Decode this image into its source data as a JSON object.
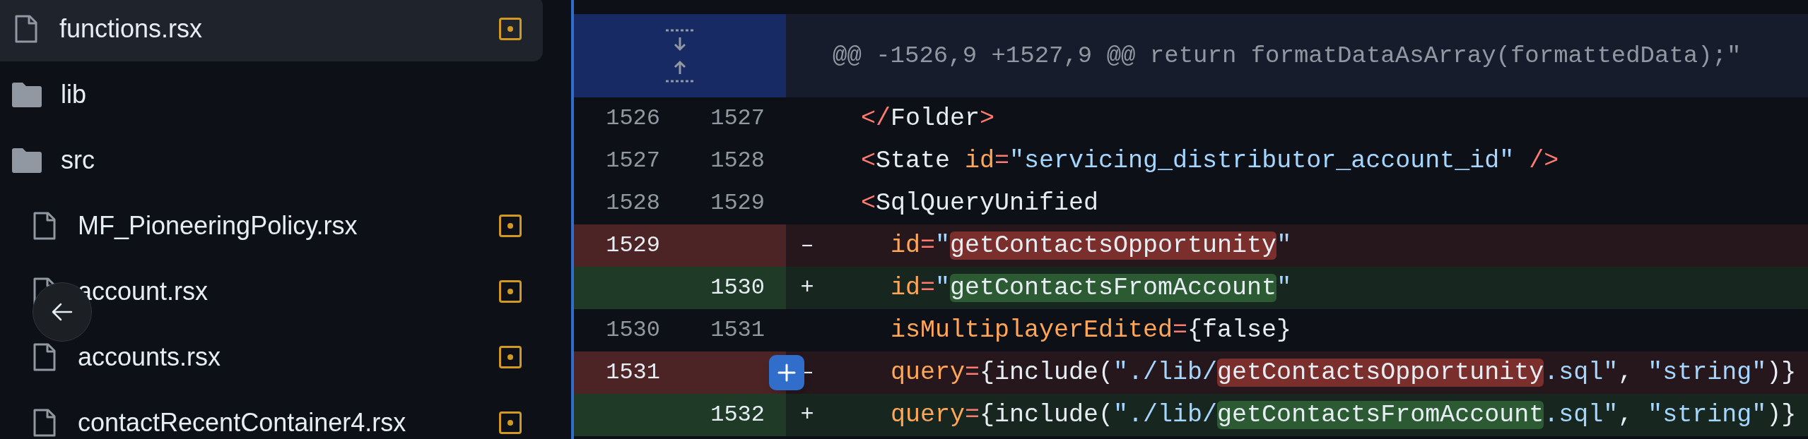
{
  "sidebar": {
    "items": [
      {
        "kind": "file",
        "name": "functions.rsx",
        "selected": true,
        "modified": true
      },
      {
        "kind": "folder",
        "name": "lib",
        "selected": false
      },
      {
        "kind": "folder",
        "name": "src",
        "selected": false,
        "children": [
          {
            "kind": "file",
            "name": "MF_PioneeringPolicy.rsx",
            "selected": false,
            "modified": true
          },
          {
            "kind": "file",
            "name": "account.rsx",
            "selected": false,
            "modified": true
          },
          {
            "kind": "file",
            "name": "accounts.rsx",
            "selected": false,
            "modified": true
          },
          {
            "kind": "file",
            "name": "contactRecentContainer4.rsx",
            "selected": false,
            "modified": true
          }
        ]
      }
    ]
  },
  "diff": {
    "hunk_header": "@@ -1526,9 +1527,9 @@ return formatDataAsArray(formattedData);\"",
    "lines": [
      {
        "kind": "context",
        "old": "1526",
        "new": "1527",
        "tokens": [
          {
            "text": "</",
            "kind": "punct",
            "highlight": false
          },
          {
            "text": "Folder",
            "kind": "tag",
            "highlight": false
          },
          {
            "text": ">",
            "kind": "punct",
            "highlight": false
          }
        ]
      },
      {
        "kind": "context",
        "old": "1527",
        "new": "1528",
        "tokens": [
          {
            "text": "<",
            "kind": "punct",
            "highlight": false
          },
          {
            "text": "State",
            "kind": "tag",
            "highlight": false
          },
          {
            "text": " id",
            "kind": "attr",
            "highlight": false
          },
          {
            "text": "=",
            "kind": "punct",
            "highlight": false
          },
          {
            "text": "\"servicing_distributor_account_id\"",
            "kind": "string",
            "highlight": false
          },
          {
            "text": " />",
            "kind": "punct",
            "highlight": false
          }
        ]
      },
      {
        "kind": "context",
        "old": "1528",
        "new": "1529",
        "tokens": [
          {
            "text": "<",
            "kind": "punct",
            "highlight": false
          },
          {
            "text": "SqlQueryUnified",
            "kind": "tag",
            "highlight": false
          }
        ]
      },
      {
        "kind": "deleted",
        "old": "1529",
        "sign": "–",
        "tokens": [
          {
            "text": "  id",
            "kind": "attr",
            "highlight": false
          },
          {
            "text": "=",
            "kind": "punct",
            "highlight": false
          },
          {
            "text": "\"",
            "kind": "string",
            "highlight": false
          },
          {
            "text": "getContactsOpportunity",
            "kind": "text",
            "highlight": true
          },
          {
            "text": "\"",
            "kind": "string",
            "highlight": false
          }
        ]
      },
      {
        "kind": "added",
        "new": "1530",
        "sign": "+",
        "tokens": [
          {
            "text": "  id",
            "kind": "attr",
            "highlight": false
          },
          {
            "text": "=",
            "kind": "punct",
            "highlight": false
          },
          {
            "text": "\"",
            "kind": "string",
            "highlight": false
          },
          {
            "text": "getContactsFromAccount",
            "kind": "text",
            "highlight": true
          },
          {
            "text": "\"",
            "kind": "string",
            "highlight": false
          }
        ]
      },
      {
        "kind": "context",
        "old": "1530",
        "new": "1531",
        "tokens": [
          {
            "text": "  isMultiplayerEdited",
            "kind": "attr",
            "highlight": false
          },
          {
            "text": "=",
            "kind": "punct",
            "highlight": false
          },
          {
            "text": "{false}",
            "kind": "text",
            "highlight": false
          }
        ]
      },
      {
        "kind": "deleted",
        "old": "1531",
        "sign": "–",
        "tokens": [
          {
            "text": "  query",
            "kind": "attr",
            "highlight": false
          },
          {
            "text": "=",
            "kind": "punct",
            "highlight": false
          },
          {
            "text": "{include(",
            "kind": "text",
            "highlight": false
          },
          {
            "text": "\"./lib/",
            "kind": "string",
            "highlight": false
          },
          {
            "text": "getContactsOpportunity",
            "kind": "text",
            "highlight": true
          },
          {
            "text": ".sql\"",
            "kind": "string",
            "highlight": false
          },
          {
            "text": ", ",
            "kind": "text",
            "highlight": false
          },
          {
            "text": "\"string\"",
            "kind": "string",
            "highlight": false
          },
          {
            "text": ")}",
            "kind": "text",
            "highlight": false
          }
        ]
      },
      {
        "kind": "added",
        "new": "1532",
        "sign": "+",
        "tokens": [
          {
            "text": "  query",
            "kind": "attr",
            "highlight": false
          },
          {
            "text": "=",
            "kind": "punct",
            "highlight": false
          },
          {
            "text": "{include(",
            "kind": "text",
            "highlight": false
          },
          {
            "text": "\"./lib/",
            "kind": "string",
            "highlight": false
          },
          {
            "text": "getContactsFromAccount",
            "kind": "text",
            "highlight": true
          },
          {
            "text": ".sql\"",
            "kind": "string",
            "highlight": false
          },
          {
            "text": ", ",
            "kind": "text",
            "highlight": false
          },
          {
            "text": "\"string\"",
            "kind": "string",
            "highlight": false
          },
          {
            "text": ")}",
            "kind": "text",
            "highlight": false
          }
        ]
      }
    ]
  }
}
